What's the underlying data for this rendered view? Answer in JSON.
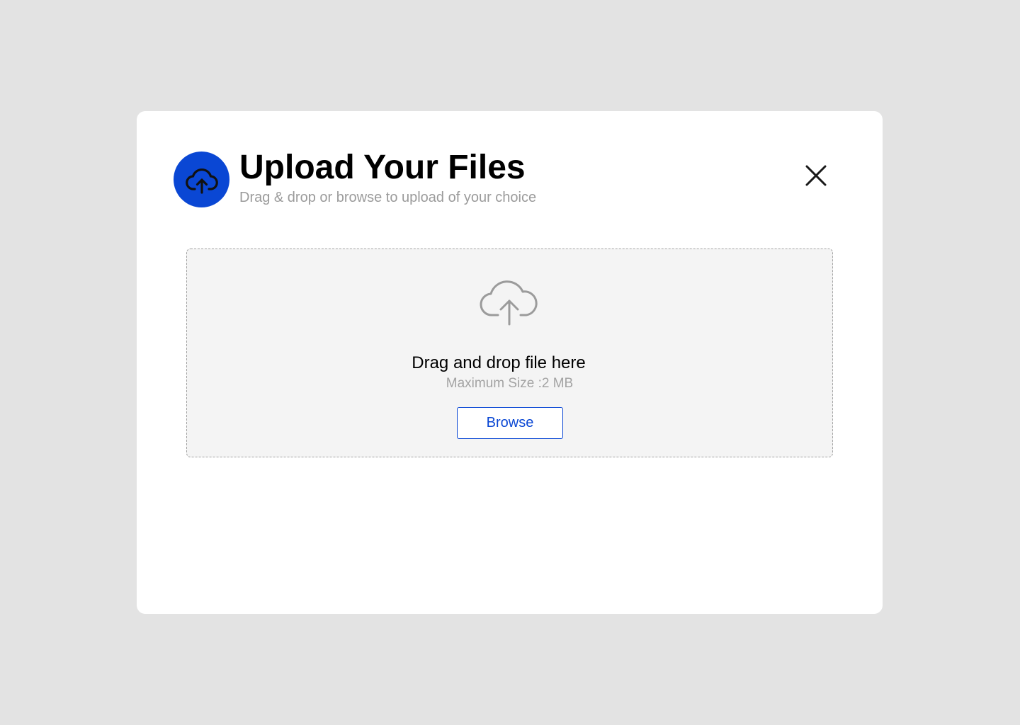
{
  "header": {
    "title": "Upload Your Files",
    "subtitle": "Drag & drop or browse to upload of your choice",
    "icon": "cloud-upload-icon",
    "accent_color": "#0a47d4",
    "close_icon": "close-icon"
  },
  "dropzone": {
    "icon": "cloud-upload-icon",
    "title": "Drag and drop file here",
    "max_size": "Maximum Size :2 MB",
    "browse_label": "Browse"
  }
}
